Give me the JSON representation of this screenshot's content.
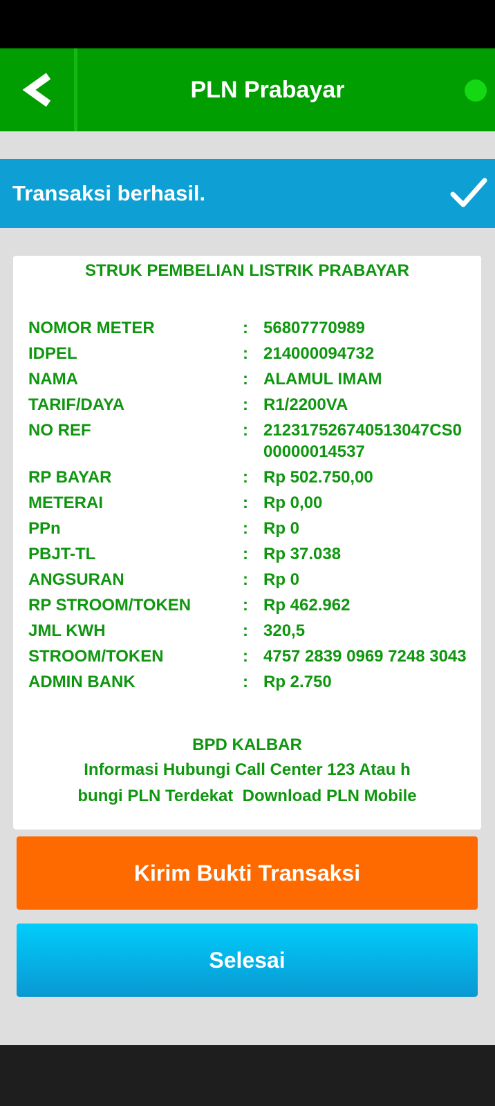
{
  "header": {
    "title": "PLN Prabayar",
    "back_icon": "chevron-left-icon",
    "accent": "#009e00"
  },
  "banner": {
    "text": "Transaksi berhasil.",
    "icon": "checkmark-icon",
    "color": "#0e9fd4"
  },
  "receipt": {
    "title": "STRUK PEMBELIAN LISTRIK PRABAYAR",
    "separator": ":",
    "rows": [
      {
        "label": "NOMOR METER",
        "value": "56807770989"
      },
      {
        "label": "IDPEL",
        "value": "214000094732"
      },
      {
        "label": "NAMA",
        "value": "ALAMUL IMAM"
      },
      {
        "label": "TARIF/DAYA",
        "value": "R1/2200VA"
      },
      {
        "label": "NO REF",
        "value": "212317526740513047CS000000014537"
      },
      {
        "label": "RP BAYAR",
        "value": "Rp 502.750,00"
      },
      {
        "label": "METERAI",
        "value": "Rp 0,00"
      },
      {
        "label": "PPn",
        "value": "Rp 0"
      },
      {
        "label": "PBJT-TL",
        "value": "Rp 37.038"
      },
      {
        "label": "ANGSURAN",
        "value": "Rp 0"
      },
      {
        "label": "RP STROOM/TOKEN",
        "value": "Rp 462.962"
      },
      {
        "label": "JML KWH",
        "value": "320,5"
      },
      {
        "label": "STROOM/TOKEN",
        "value": "4757 2839 0969 7248 3043"
      },
      {
        "label": "ADMIN BANK",
        "value": "Rp 2.750"
      }
    ],
    "footer": {
      "bank": "BPD KALBAR",
      "line1": "Informasi Hubungi Call Center 123 Atau h",
      "line2": "bungi PLN Terdekat  Download PLN Mobile"
    },
    "text_color": "#0f960f"
  },
  "buttons": {
    "send_receipt": "Kirim Bukti Transaksi",
    "done": "Selesai",
    "send_color": "#ff6a00",
    "done_color": "#0eb6ea"
  }
}
